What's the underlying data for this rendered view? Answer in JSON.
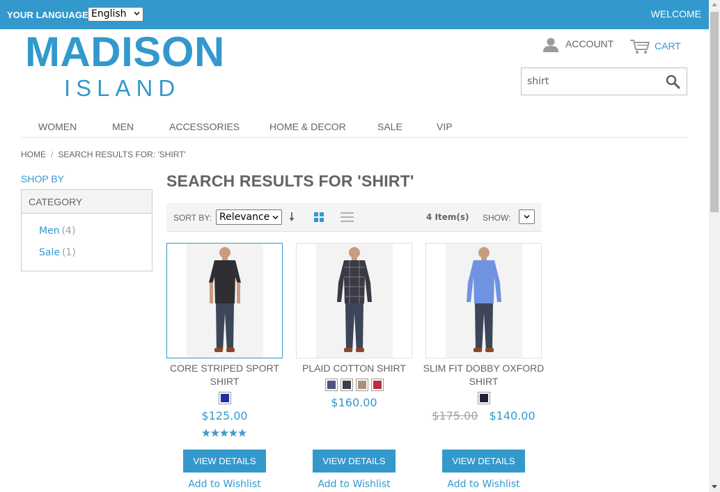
{
  "topbar": {
    "language_label": "YOUR LANGUAGE:",
    "language_value": "English",
    "welcome": "WELCOME"
  },
  "logo": {
    "line1": "MADISON",
    "line2": "ISLAND"
  },
  "header": {
    "account_label": "ACCOUNT",
    "cart_label": "CART",
    "search_value": "shirt"
  },
  "nav": {
    "items": [
      "WOMEN",
      "MEN",
      "ACCESSORIES",
      "HOME & DECOR",
      "SALE",
      "VIP"
    ]
  },
  "breadcrumb": {
    "home": "HOME",
    "separator": "/",
    "current": "SEARCH RESULTS FOR: 'SHIRT'"
  },
  "sidebar": {
    "title": "SHOP BY",
    "section": "CATEGORY",
    "items": [
      {
        "label": "Men",
        "count": "(4)"
      },
      {
        "label": "Sale",
        "count": "(1)"
      }
    ]
  },
  "main": {
    "title": "SEARCH RESULTS FOR 'SHIRT'",
    "toolbar": {
      "sort_label": "SORT BY:",
      "sort_value": "Relevance",
      "item_count": "4 Item(s)",
      "show_label": "SHOW:"
    }
  },
  "products": [
    {
      "name": "CORE STRIPED SPORT SHIRT",
      "price": "$125.00",
      "rating": 5,
      "swatch_colors": [
        "#1a2fa8"
      ],
      "shirt_color": "#2e2e33",
      "button": "VIEW DETAILS",
      "wishlist": "Add to Wishlist"
    },
    {
      "name": "PLAID COTTON SHIRT",
      "price": "$160.00",
      "swatch_colors": [
        "#4a5578",
        "#3d3d45",
        "#a8937a",
        "#b83040"
      ],
      "shirt_color": "#3a3a44",
      "button": "VIEW DETAILS",
      "wishlist": "Add to Wishlist"
    },
    {
      "name": "SLIM FIT DOBBY OXFORD SHIRT",
      "old_price": "$175.00",
      "price": "$140.00",
      "swatch_colors": [
        "#1c2338"
      ],
      "shirt_color": "#6f93e0",
      "button": "VIEW DETAILS",
      "wishlist": "Add to Wishlist"
    }
  ],
  "colors": {
    "accent": "#3399cc",
    "text": "#636363",
    "muted": "#a0a0a0"
  }
}
